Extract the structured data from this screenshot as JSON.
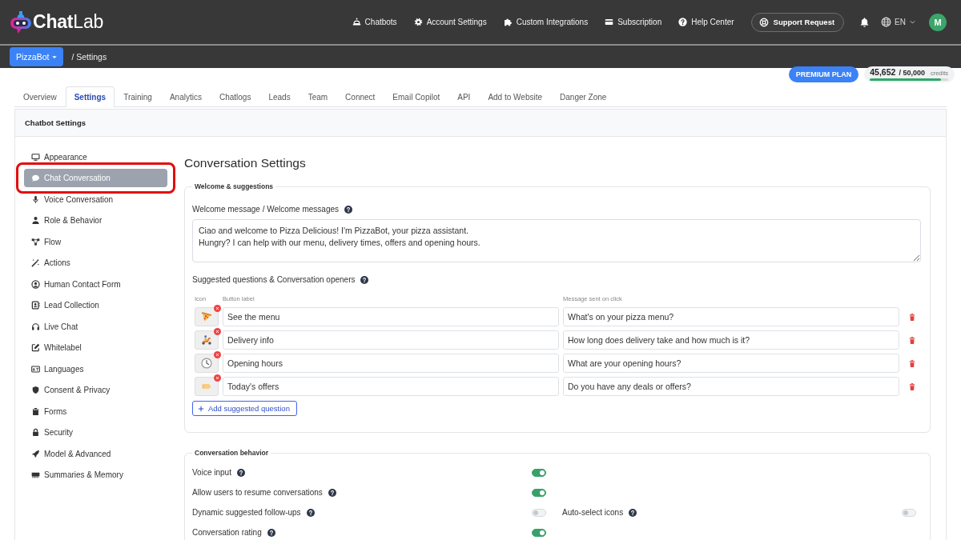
{
  "header": {
    "logo": "**Chat**Lab",
    "nav": [
      {
        "label": "Chatbots"
      },
      {
        "label": "Account Settings"
      },
      {
        "label": "Custom Integrations"
      },
      {
        "label": "Subscription"
      },
      {
        "label": "Help Center"
      }
    ],
    "support_button": "Support Request",
    "language": "EN",
    "avatar": "M"
  },
  "breadcrumb": {
    "bot": "PizzaBot",
    "path": "/ Settings"
  },
  "plan": {
    "badge": "PREMIUM PLAN",
    "used": "45,652",
    "total": "/ 50,000",
    "unit": "credits",
    "level": 0.91
  },
  "tabs": [
    {
      "label": "Overview",
      "selected": false
    },
    {
      "label": "Settings",
      "selected": true
    },
    {
      "label": "Training",
      "selected": false
    },
    {
      "label": "Analytics",
      "selected": false
    },
    {
      "label": "Chatlogs",
      "selected": false
    },
    {
      "label": "Leads",
      "selected": false
    },
    {
      "label": "Team",
      "selected": false
    },
    {
      "label": "Connect",
      "selected": false
    },
    {
      "label": "Email Copilot",
      "selected": false
    },
    {
      "label": "API",
      "selected": false
    },
    {
      "label": "Add to Website",
      "selected": false
    },
    {
      "label": "Danger Zone",
      "selected": false
    }
  ],
  "card": {
    "title": "Chatbot Settings"
  },
  "sidebar": {
    "items": [
      {
        "label": "Appearance",
        "selected": false,
        "highlighted": false
      },
      {
        "label": "Chat Conversation",
        "selected": true,
        "highlighted": true
      },
      {
        "label": "Voice Conversation",
        "selected": false,
        "highlighted": false
      },
      {
        "label": "Role & Behavior",
        "selected": false,
        "highlighted": false
      },
      {
        "label": "Flow",
        "selected": false,
        "highlighted": false
      },
      {
        "label": "Actions",
        "selected": false,
        "highlighted": false
      },
      {
        "label": "Human Contact Form",
        "selected": false,
        "highlighted": false
      },
      {
        "label": "Lead Collection",
        "selected": false,
        "highlighted": false
      },
      {
        "label": "Live Chat",
        "selected": false,
        "highlighted": false
      },
      {
        "label": "Whitelabel",
        "selected": false,
        "highlighted": false
      },
      {
        "label": "Languages",
        "selected": false,
        "highlighted": false
      },
      {
        "label": "Consent & Privacy",
        "selected": false,
        "highlighted": false
      },
      {
        "label": "Forms",
        "selected": false,
        "highlighted": false
      },
      {
        "label": "Security",
        "selected": false,
        "highlighted": false
      },
      {
        "label": "Model & Advanced",
        "selected": false,
        "highlighted": false
      },
      {
        "label": "Summaries & Memory",
        "selected": false,
        "highlighted": false
      }
    ]
  },
  "content": {
    "title": "Conversation Settings",
    "welcome": {
      "legend": "Welcome & suggestions",
      "message_label": "Welcome message / Welcome messages",
      "message": "Ciao and welcome to Pizza Delicious! I'm PizzaBot, your pizza assistant.\nHungry? I can help with our menu, delivery times, offers and opening hours.",
      "suggestions_label": "Suggested questions & Conversation openers",
      "columns": [
        "Icon",
        "Button label",
        "Message sent on click"
      ],
      "suggestions": [
        {
          "label": "See the menu",
          "message": "What's on your pizza menu?"
        },
        {
          "label": "Delivery info",
          "message": "How long does delivery take and how much is it?"
        },
        {
          "label": "Opening hours",
          "message": "What are your opening hours?"
        },
        {
          "label": "Today's offers",
          "message": "Do you have any deals or offers?"
        }
      ],
      "add_button": "Add suggested question"
    },
    "behavior": {
      "legend": "Conversation behavior",
      "rows": [
        {
          "label": "Voice input",
          "on": true
        },
        {
          "label": "Allow users to resume conversations",
          "on": true
        },
        {
          "label": "Dynamic suggested follow-ups",
          "on": false,
          "side": {
            "label": "Auto-select icons",
            "on": false
          }
        },
        {
          "label": "Conversation rating",
          "on": true
        }
      ]
    }
  }
}
